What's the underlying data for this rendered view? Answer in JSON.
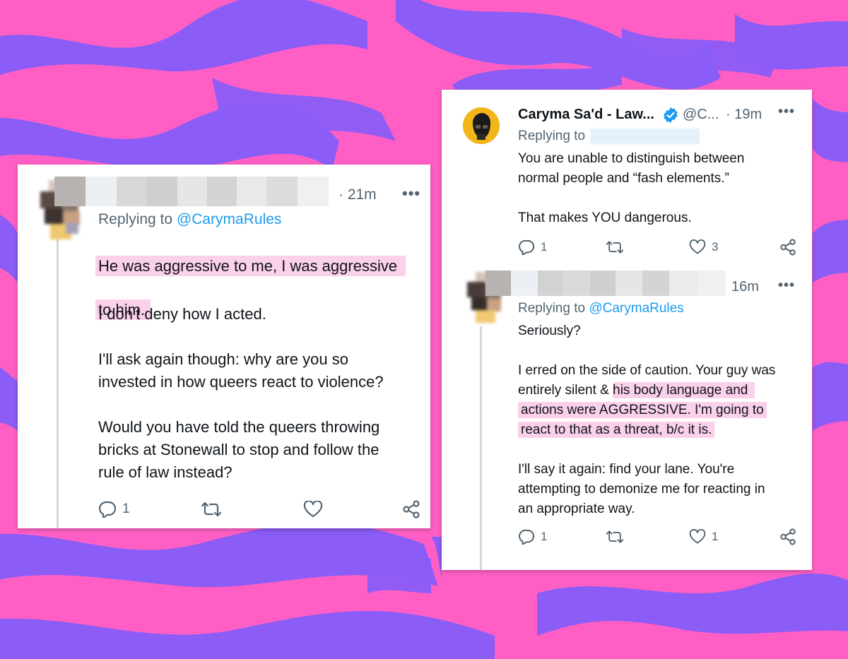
{
  "left_tweet": {
    "time": "· 21m",
    "replying_prefix": "Replying to",
    "replying_handle": "@CarymaRules",
    "highlight_line1": "He was aggressive to me, I was aggressive",
    "highlight_line2": "to him.",
    "body": "I don't deny how I acted.\n\nI'll ask again though: why are you so\ninvested in how queers react to violence?\n\nWould you have told the queers throwing\nbricks at Stonewall to stop and follow the\nrule of law instead?",
    "reply_count": "1",
    "retweet_count": "",
    "like_count": ""
  },
  "right_tweet_1": {
    "name": "Caryma Sa'd - Law...",
    "handle": "@C...",
    "time": "· 19m",
    "replying_prefix": "Replying to",
    "body": "You are unable to distinguish between\nnormal people and “fash elements.”\n\nThat makes YOU dangerous.",
    "reply_count": "1",
    "retweet_count": "",
    "like_count": "3"
  },
  "right_tweet_2": {
    "time": "16m",
    "replying_prefix": "Replying to",
    "replying_handle": "@CarymaRules",
    "line1": "Seriously?",
    "line2": "I erred on the side of caution. Your guy was",
    "line3_plain": "entirely silent & ",
    "line3_hl": "his body language and",
    "line4_hl": "actions were AGGRESSIVE. I'm going to",
    "line5_hl": "react to that as a threat, b/c it is.",
    "body_end": "I'll say it again: find your lane. You're\nattempting to demonize me for reacting in\nan appropriate way.",
    "reply_count": "1",
    "retweet_count": "",
    "like_count": "1"
  },
  "icons": {
    "reply": "reply-icon",
    "retweet": "retweet-icon",
    "like": "heart-icon",
    "share": "share-icon",
    "more": "more-icon",
    "verified": "verified-badge-icon"
  },
  "colors": {
    "background_pink": "#ff5fc4",
    "background_purple": "#8b5cf6",
    "highlight": "#fbd0ea",
    "link": "#1d9bf0",
    "muted": "#536471",
    "verified": "#1d9bf0"
  }
}
